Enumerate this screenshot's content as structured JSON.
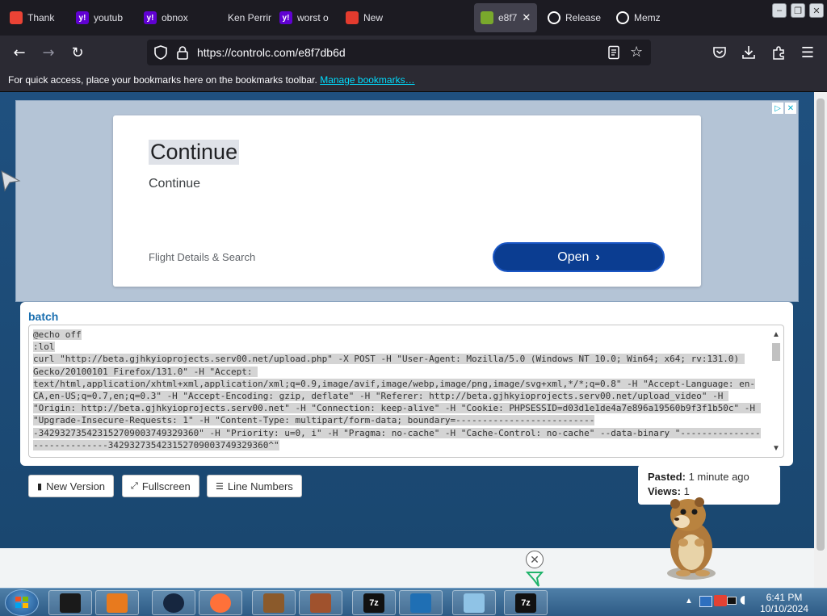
{
  "tabs": [
    {
      "label": "Thank",
      "icon": "gmail-icon",
      "color": "#ea4335"
    },
    {
      "label": "youtub",
      "icon": "yahoo-icon",
      "color": "#6001d2"
    },
    {
      "label": "obnox",
      "icon": "yahoo-icon",
      "color": "#6001d2"
    },
    {
      "label": "Ken Perrine",
      "icon": "generic-icon",
      "color": "#1c1b22"
    },
    {
      "label": "worst o",
      "icon": "yahoo-icon",
      "color": "#6001d2"
    },
    {
      "label": "New",
      "icon": "red-dot-icon",
      "color": "#e33b2e"
    },
    {
      "label": "e8f7",
      "icon": "controlc-icon",
      "color": "#79a92c",
      "active": true
    },
    {
      "label": "Release",
      "icon": "github-icon",
      "color": "#ffffff"
    },
    {
      "label": "Memz",
      "icon": "github-icon",
      "color": "#ffffff"
    }
  ],
  "nav": {
    "url": "https://controlc.com/e8f7db6d",
    "url_prefix": "https://",
    "url_host": "controlc.com/e8f7db6d"
  },
  "bookmarks": {
    "message": "For quick access, place your bookmarks here on the bookmarks toolbar.",
    "link": "Manage bookmarks…"
  },
  "ad": {
    "title": "Continue",
    "subtitle": "Continue",
    "footer": "Flight Details & Search",
    "button": "Open"
  },
  "paste": {
    "language": "batch",
    "lines": [
      "@echo off",
      ":lol",
      "curl \"http://beta.gjhkyioprojects.serv00.net/upload.php\" -X POST -H \"User-Agent: Mozilla/5.0 (Windows NT 10.0; Win64; x64; rv:131.0) Gecko/20100101 Firefox/131.0\" -H \"Accept: text/html,application/xhtml+xml,application/xml;q=0.9,image/avif,image/webp,image/png,image/svg+xml,*/*;q=0.8\" -H \"Accept-Language: en-CA,en-US;q=0.7,en;q=0.3\" -H \"Accept-Encoding: gzip, deflate\" -H \"Referer: http://beta.gjhkyioprojects.serv00.net/upload_video\" -H \"Origin: http://beta.gjhkyioprojects.serv00.net\" -H \"Connection: keep-alive\" -H \"Cookie: PHPSESSID=d03d1e1de4a7e896a19560b9f3f1b50c\" -H \"Upgrade-Insecure-Requests: 1\" -H \"Content-Type: multipart/form-data; boundary=---------------------------342932735423152709003749329360\" -H \"Priority: u=0, i\" -H \"Pragma: no-cache\" -H \"Cache-Control: no-cache\" --data-binary \"-----------------------------342932735423152709003749329360^\""
    ]
  },
  "buttons": {
    "new_version": "New Version",
    "fullscreen": "Fullscreen",
    "line_numbers": "Line Numbers"
  },
  "meta": {
    "pasted_label": "Pasted:",
    "pasted_value": "1 minute ago",
    "views_label": "Views:",
    "views_value": "1"
  },
  "taskbar": {
    "time": "6:41 PM",
    "date": "10/10/2024",
    "items": [
      {
        "icon": "terminal-icon",
        "color": "#1a1a1a"
      },
      {
        "icon": "media-player-icon",
        "color": "#e87a1e"
      },
      {
        "icon": "globe-icon",
        "color": "#16263f"
      },
      {
        "icon": "firefox-icon",
        "color": "#ff7139"
      },
      {
        "icon": "bonzi-box-icon",
        "color": "#8b5a2b"
      },
      {
        "icon": "gopher-icon",
        "color": "#a0522d"
      },
      {
        "icon": "7zip-icon",
        "color": "#111111",
        "text": "7z"
      },
      {
        "icon": "monitor-icon",
        "color": "#1f6fb4"
      },
      {
        "icon": "notepad-icon",
        "color": "#8fc3e6"
      },
      {
        "icon": "7zip-icon",
        "color": "#111111",
        "text": "7z"
      }
    ]
  }
}
